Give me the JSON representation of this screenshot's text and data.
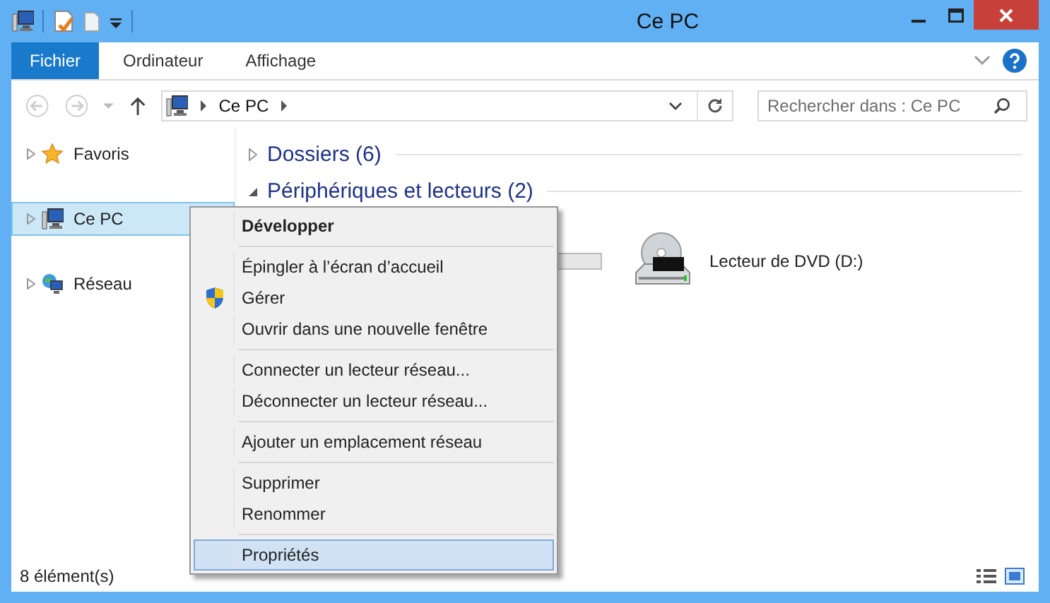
{
  "window": {
    "title": "Ce PC"
  },
  "ribbon": {
    "tabs": [
      {
        "label": "Fichier",
        "selected": true
      },
      {
        "label": "Ordinateur",
        "selected": false
      },
      {
        "label": "Affichage",
        "selected": false
      }
    ]
  },
  "navigation": {
    "back_disabled": true,
    "forward_disabled": true,
    "path": [
      "Ce PC"
    ]
  },
  "search": {
    "placeholder": "Rechercher dans : Ce PC"
  },
  "sidebar": {
    "items": [
      {
        "label": "Favoris",
        "kind": "favorites",
        "selected": false,
        "expanded": false
      },
      {
        "label": "Ce PC",
        "kind": "computer",
        "selected": true,
        "expanded": false
      },
      {
        "label": "Réseau",
        "kind": "network",
        "selected": false,
        "expanded": false
      }
    ]
  },
  "groups": [
    {
      "title": "Dossiers (6)",
      "expanded": false
    },
    {
      "title": "Périphériques et lecteurs (2)",
      "expanded": true,
      "items": [
        {
          "kind": "hidden-drive"
        },
        {
          "kind": "dvd",
          "label": "Lecteur de DVD (D:)"
        }
      ]
    }
  ],
  "status_bar": {
    "count": "8 élément(s)"
  },
  "context_menu": {
    "groups": [
      [
        {
          "label": "Développer",
          "default": true,
          "elevated": false,
          "selected": false
        }
      ],
      [
        {
          "label": "Épingler à l’écran d’accueil",
          "default": false,
          "elevated": false,
          "selected": false
        },
        {
          "label": "Gérer",
          "default": false,
          "elevated": true,
          "selected": false
        },
        {
          "label": "Ouvrir dans une nouvelle fenêtre",
          "default": false,
          "elevated": false,
          "selected": false
        }
      ],
      [
        {
          "label": "Connecter un lecteur réseau...",
          "default": false,
          "elevated": false,
          "selected": false
        },
        {
          "label": "Déconnecter un lecteur réseau...",
          "default": false,
          "elevated": false,
          "selected": false
        }
      ],
      [
        {
          "label": "Ajouter un emplacement réseau",
          "default": false,
          "elevated": false,
          "selected": false
        }
      ],
      [
        {
          "label": "Supprimer",
          "default": false,
          "elevated": false,
          "selected": false
        },
        {
          "label": "Renommer",
          "default": false,
          "elevated": false,
          "selected": false
        }
      ],
      [
        {
          "label": "Propriétés",
          "default": false,
          "elevated": false,
          "selected": true
        }
      ]
    ]
  }
}
